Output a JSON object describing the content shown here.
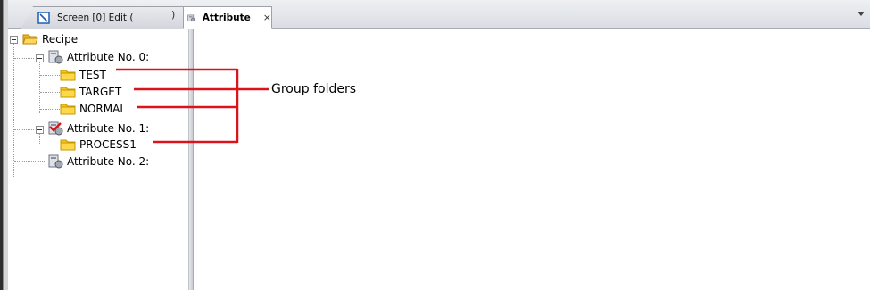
{
  "tabs": {
    "screen_tab": {
      "label": "Screen [0] Edit (",
      "close_glyph": ")",
      "icon": "screen-edit-icon"
    },
    "attribute_tab": {
      "label": "Attribute",
      "close_glyph": "×",
      "icon": "attribute-icon",
      "active": true
    }
  },
  "tree": {
    "root": {
      "label": "Recipe",
      "icon": "folder-open-icon"
    },
    "attributes": [
      {
        "label": "Attribute No. 0:",
        "icon": "attribute-node-icon",
        "groups": [
          {
            "label": "TEST",
            "icon": "folder-icon"
          },
          {
            "label": "TARGET",
            "icon": "folder-icon"
          },
          {
            "label": "NORMAL",
            "icon": "folder-icon"
          }
        ]
      },
      {
        "label": "Attribute No. 1:",
        "icon": "attribute-node-checked-icon",
        "groups": [
          {
            "label": "PROCESS1",
            "icon": "folder-icon"
          }
        ]
      },
      {
        "label": "Attribute No. 2:",
        "icon": "attribute-node-icon",
        "groups": []
      }
    ]
  },
  "annotation": {
    "label": "Group folders",
    "color": "#d9141b"
  },
  "colors": {
    "folder": "#f5c518",
    "folder_dark": "#d9a400",
    "callout": "#d9141b"
  }
}
